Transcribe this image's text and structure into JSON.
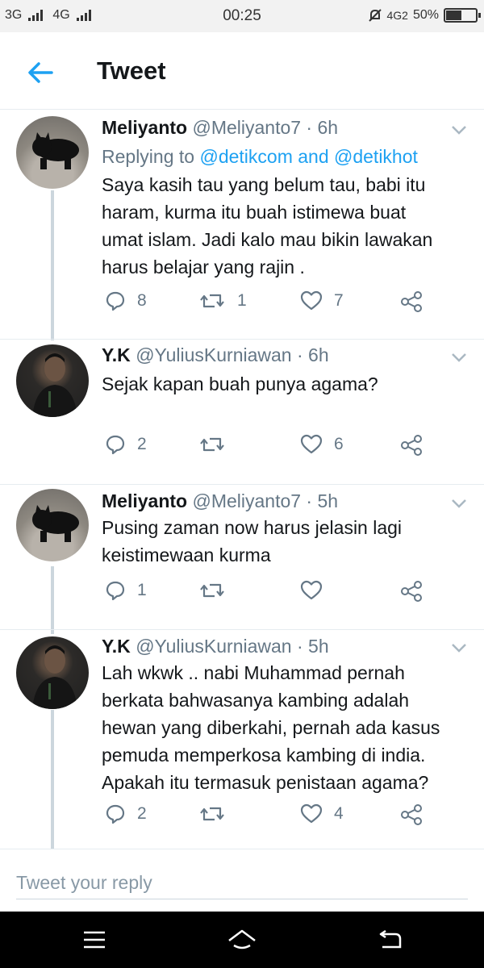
{
  "status_bar": {
    "network1": "3G",
    "network2": "4G",
    "time": "00:25",
    "network3": "4G2",
    "battery": "50%",
    "battery_level": 0.5
  },
  "header": {
    "title": "Tweet",
    "back_icon": "arrow-left-icon",
    "accent_color": "#1da1f2"
  },
  "tweets": [
    {
      "name": "Meliyanto",
      "handle": "@Meliyanto7 · 6h",
      "replying_prefix": "Replying to ",
      "replying_to": "@detikcom and @detikhot",
      "lines": [
        "Saya kasih tau yang belum tau, babi itu",
        "haram, kurma itu buah istimewa buat",
        "umat islam. Jadi kalo mau bikin lawakan",
        "harus belajar yang rajin ."
      ],
      "replies": "8",
      "retweets": "1",
      "likes": "7"
    },
    {
      "name": "Y.K",
      "handle": "@YuliusKurniawan · 6h",
      "lines": [
        "Sejak kapan buah punya agama?"
      ],
      "replies": "2",
      "retweets": "",
      "likes": "6"
    },
    {
      "name": "Meliyanto",
      "handle": "@Meliyanto7 · 5h",
      "lines": [
        "Pusing zaman now harus jelasin lagi",
        "keistimewaan kurma"
      ],
      "replies": "1",
      "retweets": "",
      "likes": ""
    },
    {
      "name": "Y.K",
      "handle": "@YuliusKurniawan · 5h",
      "lines": [
        "Lah wkwk .. nabi Muhammad pernah",
        "berkata bahwasanya kambing adalah",
        "hewan yang diberkahi, pernah ada kasus",
        "pemuda memperkosa kambing di india.",
        "Apakah itu termasuk penistaan agama?"
      ],
      "replies": "2",
      "retweets": "",
      "likes": "4"
    }
  ],
  "reply_bar": {
    "placeholder": "Tweet your reply"
  },
  "icons": {
    "reply": "reply-icon",
    "retweet": "retweet-icon",
    "like": "heart-icon",
    "share": "share-icon",
    "caret": "chevron-down-icon",
    "nav_menu": "menu-icon",
    "nav_home": "home-icon",
    "nav_back": "back-icon"
  }
}
